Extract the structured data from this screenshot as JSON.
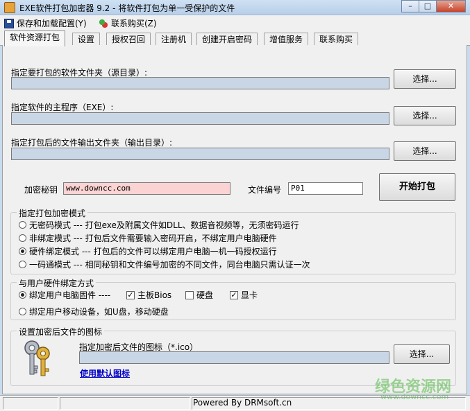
{
  "window": {
    "title": "EXE软件打包加密器 9.2 - 将软件打包为单一受保护的文件",
    "min": "–",
    "max": "□",
    "close": "✕"
  },
  "menu": {
    "save_config": "保存和加载配置(Y)",
    "purchase": "联系购买(Z)"
  },
  "tabs": [
    "软件资源打包",
    "设置",
    "授权召回",
    "注册机",
    "创建开启密码",
    "增值服务",
    "联系购买"
  ],
  "source": {
    "label": "指定要打包的软件文件夹（源目录）:",
    "value": "",
    "button": "选择..."
  },
  "main_exe": {
    "label": "指定软件的主程序（EXE）:",
    "value": "",
    "button": "选择..."
  },
  "output": {
    "label": "指定打包后的文件输出文件夹（输出目录）:",
    "value": "",
    "button": "选择..."
  },
  "key": {
    "label": "加密秘钥",
    "value": "www.downcc.com"
  },
  "file_no": {
    "label": "文件编号",
    "value": "P01"
  },
  "start_button": "开始打包",
  "mode": {
    "title": "指定打包加密模式",
    "options": [
      "无密码模式 --- 打包exe及附属文件如DLL、数据音视频等，无须密码运行",
      "非绑定模式 --- 打包后文件需要输入密码开启，不绑定用户电脑硬件",
      "硬件绑定模式 --- 打包后的文件可以绑定用户电脑一机一码授权运行",
      "一码通模式 --- 相同秘钥和文件编号加密的不同文件，同台电脑只需认证一次"
    ],
    "selected": 2
  },
  "bind": {
    "title": "与用户硬件绑定方式",
    "option1": "绑定用户电脑固件 ----",
    "option2": "绑定用户移动设备，如U盘，移动硬盘",
    "chk_board": "主板Bios",
    "chk_disk": "硬盘",
    "chk_gpu": "显卡",
    "check_mark": "✓"
  },
  "icon": {
    "title": "设置加密后文件的图标",
    "label": "指定加密后文件的图标（*.ico）",
    "value": "",
    "button": "选择...",
    "default_link": "使用默认图标"
  },
  "status": {
    "powered": "Powered By DRMsoft.cn"
  },
  "watermark": {
    "text": "绿色资源网",
    "url": "www.downcc.com"
  }
}
